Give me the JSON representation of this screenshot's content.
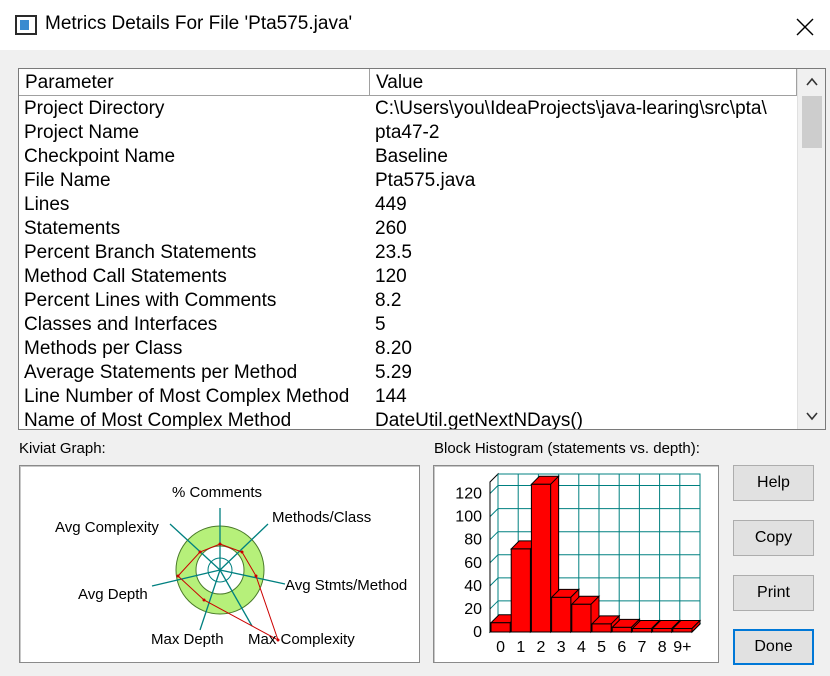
{
  "window": {
    "title": "Metrics Details For File 'Pta575.java'"
  },
  "table": {
    "headers": {
      "parameter": "Parameter",
      "value": "Value"
    },
    "rows": [
      {
        "parameter": "Project Directory",
        "value": "C:\\Users\\you\\IdeaProjects\\java-learing\\src\\pta\\"
      },
      {
        "parameter": "Project Name",
        "value": "pta47-2"
      },
      {
        "parameter": "Checkpoint Name",
        "value": "Baseline"
      },
      {
        "parameter": "File Name",
        "value": "Pta575.java"
      },
      {
        "parameter": "Lines",
        "value": "449"
      },
      {
        "parameter": "Statements",
        "value": "260"
      },
      {
        "parameter": "Percent Branch Statements",
        "value": "23.5"
      },
      {
        "parameter": "Method Call Statements",
        "value": "120"
      },
      {
        "parameter": "Percent Lines with Comments",
        "value": "8.2"
      },
      {
        "parameter": "Classes and Interfaces",
        "value": "5"
      },
      {
        "parameter": "Methods per Class",
        "value": "8.20"
      },
      {
        "parameter": "Average Statements per Method",
        "value": "5.29"
      },
      {
        "parameter": "Line Number of Most Complex Method",
        "value": "144"
      },
      {
        "parameter": "Name of Most Complex Method",
        "value": "DateUtil.getNextNDays()"
      }
    ]
  },
  "kiviat": {
    "section_label": "Kiviat Graph:",
    "axes": {
      "comments": "% Comments",
      "methods_class": "Methods/Class",
      "avg_stmts": "Avg Stmts/Method",
      "max_complexity": "Max Complexity",
      "max_depth": "Max Depth",
      "avg_depth": "Avg Depth",
      "avg_complexity": "Avg Complexity"
    }
  },
  "histogram": {
    "section_label": "Block Histogram (statements vs. depth):",
    "chart_data": {
      "type": "bar",
      "categories": [
        "0",
        "1",
        "2",
        "3",
        "4",
        "5",
        "6",
        "7",
        "8",
        "9+"
      ],
      "values": [
        8,
        72,
        128,
        30,
        24,
        7,
        4,
        3,
        3,
        3
      ],
      "ylim": [
        0,
        130
      ],
      "yticks": [
        "0",
        "20",
        "40",
        "60",
        "80",
        "100",
        "120"
      ],
      "bar_color": "#ff0000",
      "grid_color": "#008080"
    }
  },
  "buttons": {
    "help": "Help",
    "copy": "Copy",
    "print": "Print",
    "done": "Done"
  }
}
